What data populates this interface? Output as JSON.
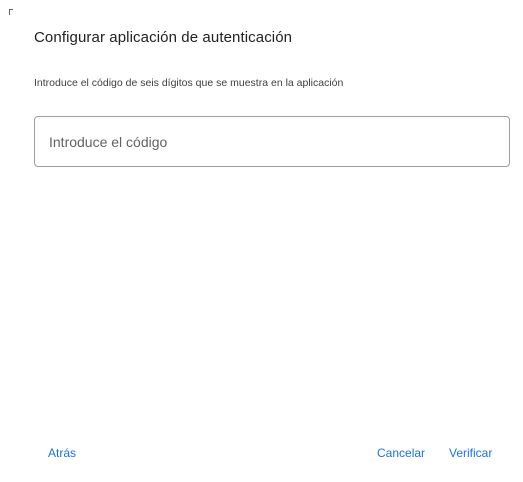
{
  "dialog": {
    "title": "Configurar aplicación de autenticación",
    "subtitle": "Introduce el código de seis dígitos que se muestra en la aplicación",
    "code_input": {
      "value": "",
      "placeholder": "Introduce el código"
    },
    "footer": {
      "back_label": "Atrás",
      "cancel_label": "Cancelar",
      "verify_label": "Verificar"
    }
  },
  "colors": {
    "accent": "#1a73e8",
    "title_text": "#202124",
    "body_text": "#3c4043",
    "input_border": "#9aa0a6"
  }
}
